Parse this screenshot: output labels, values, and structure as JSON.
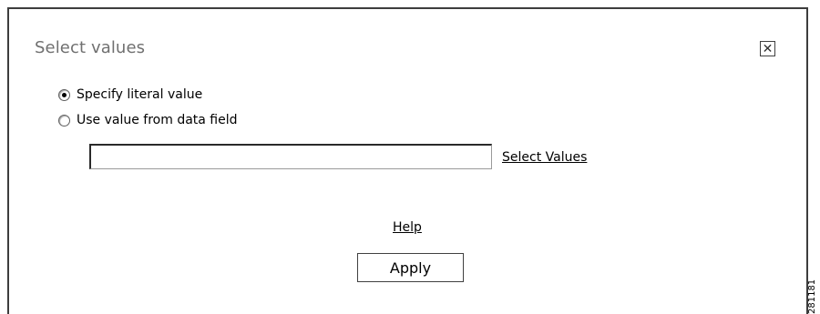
{
  "dialog": {
    "title": "Select values",
    "close_symbol": "✕"
  },
  "options": {
    "literal_label": "Specify literal value",
    "literal_selected": true,
    "data_field_label": "Use value from data field",
    "data_field_selected": false
  },
  "value_input": {
    "value": "",
    "placeholder": ""
  },
  "links": {
    "select_values": "Select Values",
    "help": "Help"
  },
  "buttons": {
    "apply": "Apply"
  },
  "figure_id": "281181"
}
